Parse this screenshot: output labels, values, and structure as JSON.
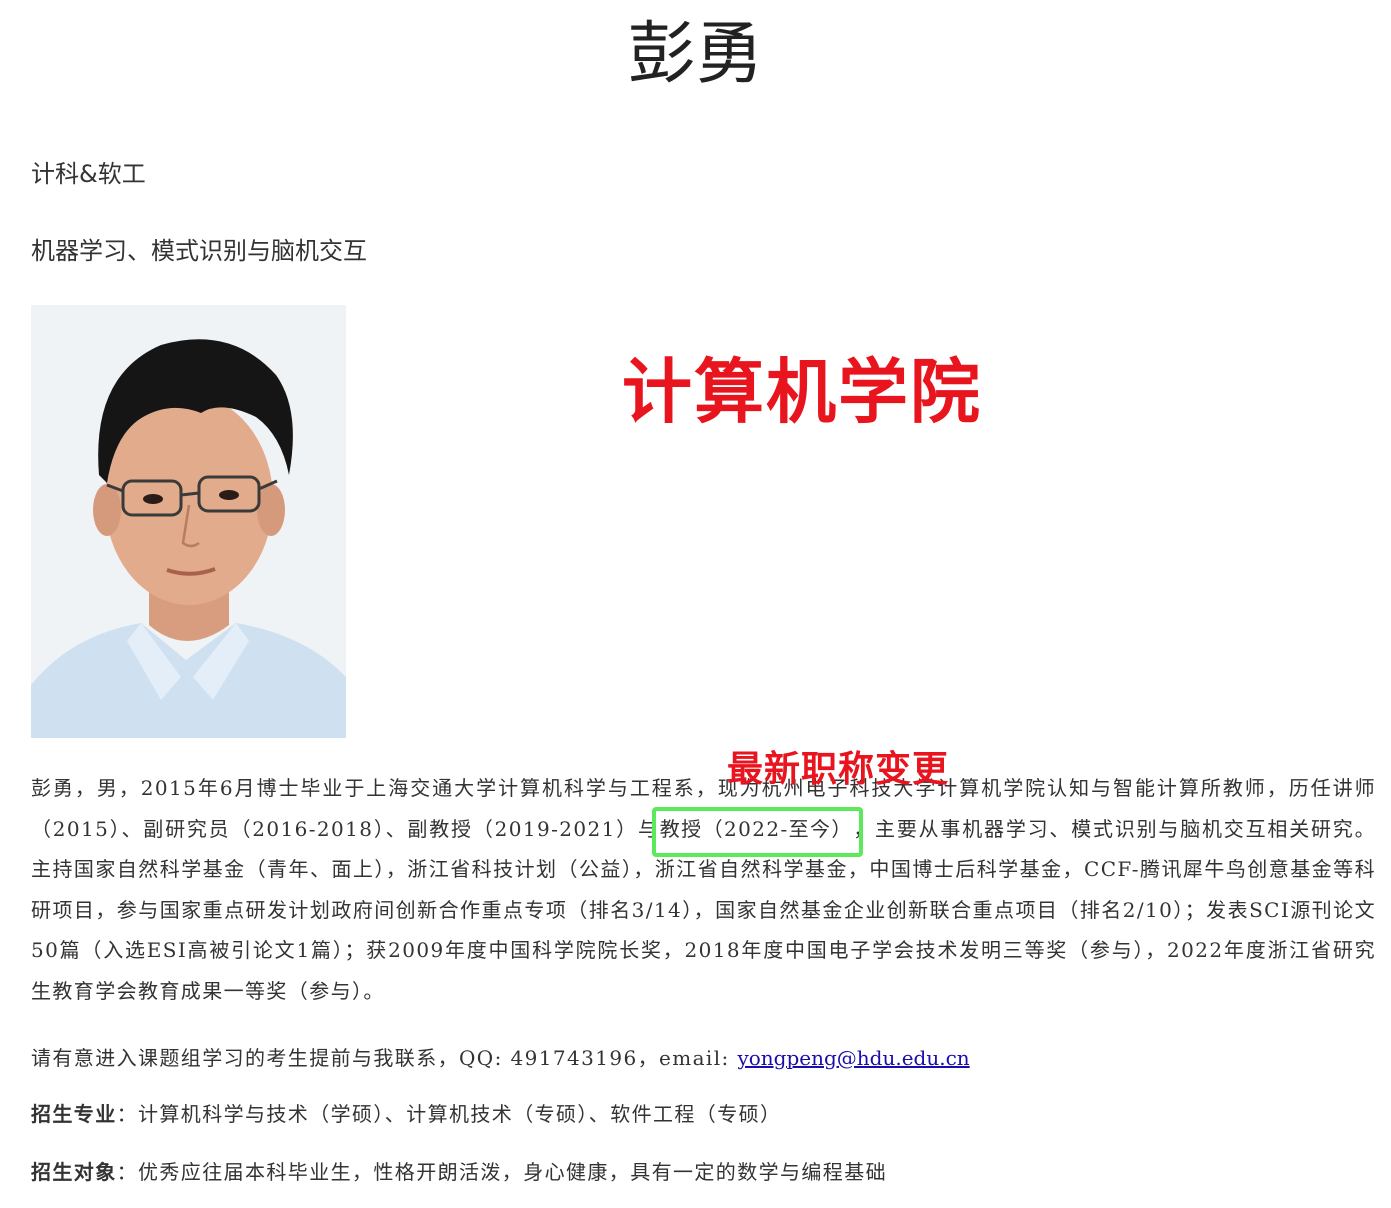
{
  "profile": {
    "name": "彭勇",
    "department": "计科&软工",
    "research_field": "机器学习、模式识别与脑机交互"
  },
  "annotations": {
    "college": "计算机学院",
    "title_change": "最新职称变更"
  },
  "bio": {
    "part1": "彭勇，男，2015年6月博士毕业于上海交通大学计算机科学与工程系，现为杭州电子科技大学计算机学院认知与智能计算所教师，历任讲师（2015）、副研究员（2016-2018）、副教授（2019-2021）与",
    "highlight": "教授（2022-至今）",
    "part2": "，主要从事机器学习、模式识别与脑机交互相关研究。主持国家自然科学基金（青年、面上），浙江省科技计划（公益），浙江省自然科学基金，中国博士后科学基金，CCF-腾讯犀牛鸟创意基金等科研项目，参与国家重点研发计划政府间创新合作重点专项（排名3/14），国家自然基金企业创新联合重点项目（排名2/10）；发表SCI源刊论文50篇（入选ESI高被引论文1篇）；获2009年度中国科学院院长奖，2018年度中国电子学会技术发明三等奖（参与），2022年度浙江省研究生教育学会教育成果一等奖（参与）。"
  },
  "contact": {
    "text": "请有意进入课题组学习的考生提前与我联系，QQ: 491743196，email: ",
    "email": "yongpeng@hdu.edu.cn"
  },
  "admission": {
    "major_label": "招生专业",
    "major_value": "：计算机科学与技术（学硕）、计算机技术（专硕）、软件工程（专硕）",
    "target_label": "招生对象",
    "target_value": "：优秀应往届本科毕业生，性格开朗活泼，身心健康，具有一定的数学与编程基础"
  },
  "colors": {
    "annotation_red": "#e8151f",
    "highlight_green": "#5ee85b",
    "link_blue": "#1a0dab"
  }
}
